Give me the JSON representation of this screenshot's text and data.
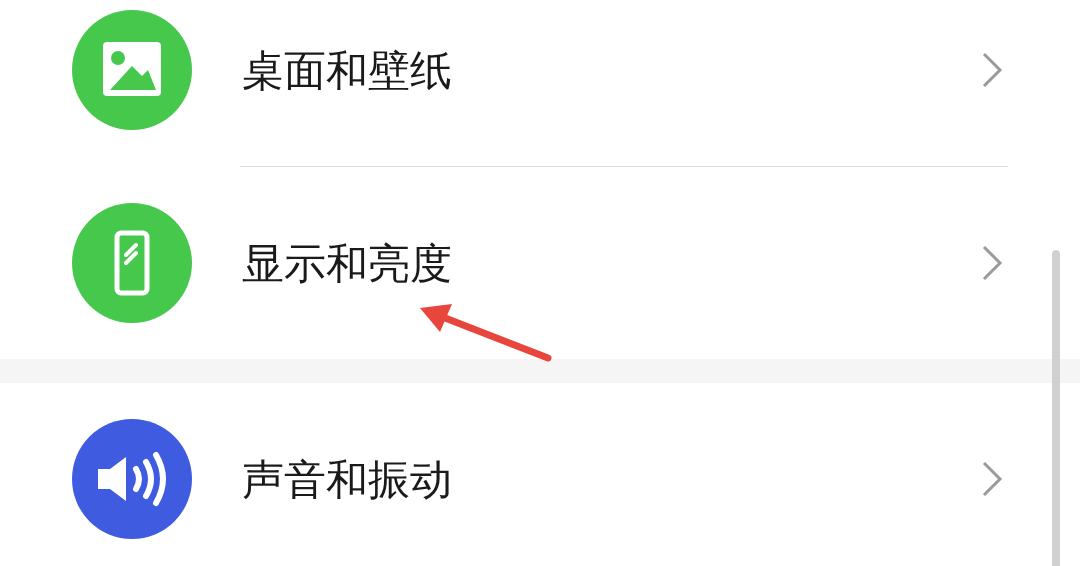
{
  "groups": [
    {
      "items": [
        {
          "label": "桌面和壁纸",
          "kind": "wallpaper",
          "color": "#45c84b"
        },
        {
          "label": "显示和亮度",
          "kind": "display",
          "color": "#45c84b"
        }
      ]
    },
    {
      "items": [
        {
          "label": "声音和振动",
          "kind": "sound",
          "color": "#3f5be0"
        }
      ]
    }
  ]
}
